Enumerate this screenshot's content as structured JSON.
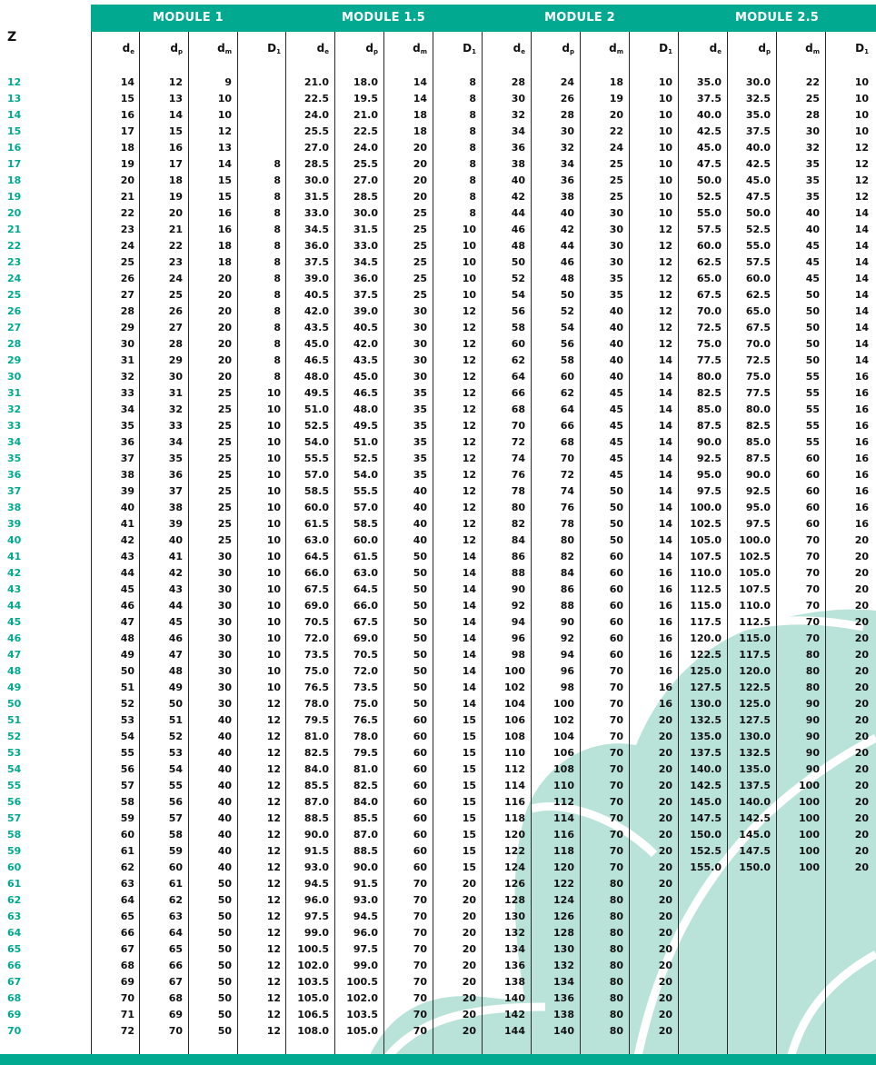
{
  "z_label": "Z",
  "colors": {
    "accent": "#00a98f",
    "z_text": "#00a98f",
    "watermark": "#b9e3d9"
  },
  "modules": [
    {
      "title": "MODULE 1"
    },
    {
      "title": "MODULE 1.5"
    },
    {
      "title": "MODULE 2"
    },
    {
      "title": "MODULE 2.5"
    }
  ],
  "column_headers": [
    {
      "base": "d",
      "sub": "e"
    },
    {
      "base": "d",
      "sub": "p"
    },
    {
      "base": "d",
      "sub": "m"
    },
    {
      "base": "D",
      "sub": "1"
    }
  ],
  "z_values": [
    12,
    13,
    14,
    15,
    16,
    17,
    18,
    19,
    20,
    21,
    22,
    23,
    24,
    25,
    26,
    27,
    28,
    29,
    30,
    31,
    32,
    33,
    34,
    35,
    36,
    37,
    38,
    39,
    40,
    41,
    42,
    43,
    44,
    45,
    46,
    47,
    48,
    49,
    50,
    51,
    52,
    53,
    54,
    55,
    56,
    57,
    58,
    59,
    60,
    61,
    62,
    63,
    64,
    65,
    66,
    67,
    68,
    69,
    70
  ],
  "module1": {
    "de_start": 14,
    "dp_start": 12,
    "dm": [
      "9",
      "10",
      "10",
      "12",
      "13",
      "14",
      "15",
      "15",
      "16",
      "16",
      "18",
      "18",
      "20",
      "20",
      "20",
      "20",
      "20",
      "20",
      "20",
      "25",
      "25",
      "25",
      "25",
      "25",
      "25",
      "25",
      "25",
      "25",
      "25",
      "30",
      "30",
      "30",
      "30",
      "30",
      "30",
      "30",
      "30",
      "30",
      "30",
      "40",
      "40",
      "40",
      "40",
      "40",
      "40",
      "40",
      "40",
      "40",
      "40",
      "50",
      "50",
      "50",
      "50",
      "50",
      "50",
      "50",
      "50",
      "50",
      "50"
    ],
    "d1": [
      "",
      "",
      "",
      "",
      "",
      "8",
      "8",
      "8",
      "8",
      "8",
      "8",
      "8",
      "8",
      "8",
      "8",
      "8",
      "8",
      "8",
      "8",
      "10",
      "10",
      "10",
      "10",
      "10",
      "10",
      "10",
      "10",
      "10",
      "10",
      "10",
      "10",
      "10",
      "10",
      "10",
      "10",
      "10",
      "10",
      "10",
      "12",
      "12",
      "12",
      "12",
      "12",
      "12",
      "12",
      "12",
      "12",
      "12",
      "12",
      "12",
      "12",
      "12",
      "12",
      "12",
      "12",
      "12",
      "12",
      "12",
      "12"
    ]
  },
  "module15": {
    "de_start": 21.0,
    "dp_start": 18.0,
    "step": 1.5,
    "dm": [
      "14",
      "14",
      "18",
      "18",
      "20",
      "20",
      "20",
      "20",
      "25",
      "25",
      "25",
      "25",
      "25",
      "25",
      "30",
      "30",
      "30",
      "30",
      "30",
      "35",
      "35",
      "35",
      "35",
      "35",
      "35",
      "40",
      "40",
      "40",
      "40",
      "50",
      "50",
      "50",
      "50",
      "50",
      "50",
      "50",
      "50",
      "50",
      "50",
      "60",
      "60",
      "60",
      "60",
      "60",
      "60",
      "60",
      "60",
      "60",
      "60",
      "70",
      "70",
      "70",
      "70",
      "70",
      "70",
      "70",
      "70",
      "70",
      "70"
    ],
    "d1": [
      "8",
      "8",
      "8",
      "8",
      "8",
      "8",
      "8",
      "8",
      "8",
      "10",
      "10",
      "10",
      "10",
      "10",
      "12",
      "12",
      "12",
      "12",
      "12",
      "12",
      "12",
      "12",
      "12",
      "12",
      "12",
      "12",
      "12",
      "12",
      "12",
      "14",
      "14",
      "14",
      "14",
      "14",
      "14",
      "14",
      "14",
      "14",
      "14",
      "15",
      "15",
      "15",
      "15",
      "15",
      "15",
      "15",
      "15",
      "15",
      "15",
      "20",
      "20",
      "20",
      "20",
      "20",
      "20",
      "20",
      "20",
      "20",
      "20"
    ]
  },
  "module2": {
    "de_start": 28,
    "dp_start": 24,
    "step": 2,
    "dm": [
      "18",
      "19",
      "20",
      "22",
      "24",
      "25",
      "25",
      "25",
      "30",
      "30",
      "30",
      "30",
      "35",
      "35",
      "40",
      "40",
      "40",
      "40",
      "40",
      "45",
      "45",
      "45",
      "45",
      "45",
      "45",
      "50",
      "50",
      "50",
      "50",
      "60",
      "60",
      "60",
      "60",
      "60",
      "60",
      "60",
      "70",
      "70",
      "70",
      "70",
      "70",
      "70",
      "70",
      "70",
      "70",
      "70",
      "70",
      "70",
      "70",
      "80",
      "80",
      "80",
      "80",
      "80",
      "80",
      "80",
      "80",
      "80",
      "80"
    ],
    "d1": [
      "10",
      "10",
      "10",
      "10",
      "10",
      "10",
      "10",
      "10",
      "10",
      "12",
      "12",
      "12",
      "12",
      "12",
      "12",
      "12",
      "12",
      "14",
      "14",
      "14",
      "14",
      "14",
      "14",
      "14",
      "14",
      "14",
      "14",
      "14",
      "14",
      "14",
      "16",
      "16",
      "16",
      "16",
      "16",
      "16",
      "16",
      "16",
      "16",
      "20",
      "20",
      "20",
      "20",
      "20",
      "20",
      "20",
      "20",
      "20",
      "20",
      "20",
      "20",
      "20",
      "20",
      "20",
      "20",
      "20",
      "20",
      "20",
      "20"
    ]
  },
  "module25": {
    "de_start": 35.0,
    "dp_start": 30.0,
    "step": 2.5,
    "rows": 49,
    "dm": [
      "22",
      "25",
      "28",
      "30",
      "32",
      "35",
      "35",
      "35",
      "40",
      "40",
      "45",
      "45",
      "45",
      "50",
      "50",
      "50",
      "50",
      "50",
      "55",
      "55",
      "55",
      "55",
      "55",
      "60",
      "60",
      "60",
      "60",
      "60",
      "70",
      "70",
      "70",
      "70",
      "70",
      "70",
      "70",
      "80",
      "80",
      "80",
      "90",
      "90",
      "90",
      "90",
      "90",
      "100",
      "100",
      "100",
      "100",
      "100",
      "100"
    ],
    "d1": [
      "10",
      "10",
      "10",
      "10",
      "12",
      "12",
      "12",
      "12",
      "14",
      "14",
      "14",
      "14",
      "14",
      "14",
      "14",
      "14",
      "14",
      "14",
      "16",
      "16",
      "16",
      "16",
      "16",
      "16",
      "16",
      "16",
      "16",
      "16",
      "20",
      "20",
      "20",
      "20",
      "20",
      "20",
      "20",
      "20",
      "20",
      "20",
      "20",
      "20",
      "20",
      "20",
      "20",
      "20",
      "20",
      "20",
      "20",
      "20",
      "20"
    ]
  }
}
